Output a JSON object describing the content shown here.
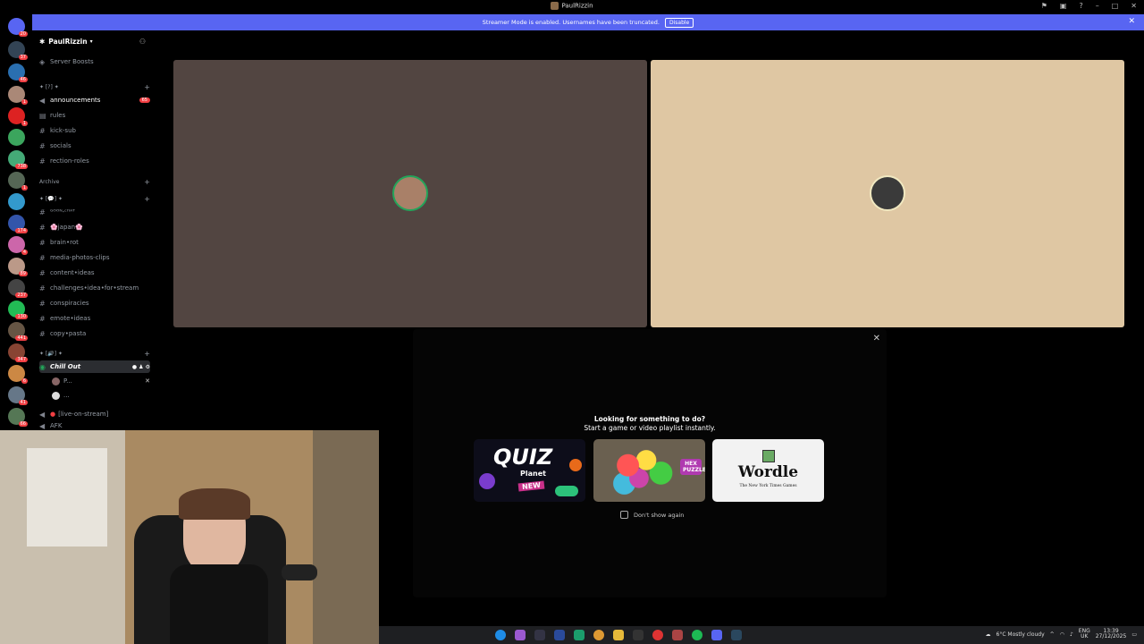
{
  "window": {
    "title": "PaulRizzin"
  },
  "streamer_banner": {
    "text": "Streamer Mode is enabled. Usernames have been truncated.",
    "disable_label": "Disable"
  },
  "server_rail": {
    "badges": [
      "20",
      "37",
      "46",
      "1",
      "1",
      "738",
      "1",
      "174",
      "4",
      "89",
      "237",
      "130",
      "441",
      "347",
      "6",
      "41",
      "66"
    ]
  },
  "sidebar": {
    "server_name": "PaulRizzin",
    "boosts_label": "Server Boosts",
    "cat1": "✦ [?] ✦",
    "channels": [
      {
        "name": "announcements",
        "badge": "65"
      },
      {
        "name": "rules"
      },
      {
        "name": "kick-sub"
      },
      {
        "name": "socials"
      },
      {
        "name": "rection-roles"
      }
    ],
    "archive_label": "Archive",
    "cat2": "✦ [💬] ✦",
    "archive_channels": [
      "ᴳᴼᴼᴺ-ᶜᴴᴬᵀ",
      "🌸japan🌸",
      "brain•rot",
      "media-photos-clips",
      "content•ideas",
      "challenges•idea•for•stream",
      "conspiracies",
      "emote•ideas",
      "copy•pasta"
    ],
    "cat3": "✦ [🔊] ✦",
    "voice_channel": "Chill Out",
    "voice_users": [
      "P...",
      "..."
    ],
    "live_channel": "[live-on-stream]",
    "afk_label": "AFK"
  },
  "activity": {
    "title_line1": "Looking for something to do?",
    "title_line2": "Start a game or video playlist instantly.",
    "cards": [
      {
        "name": "QUIZ",
        "sub": "Planet",
        "tag": "NEW"
      },
      {
        "name": "HEX PUZZLE"
      },
      {
        "name": "Wordle",
        "sub": "The New York Times Games"
      }
    ],
    "dont_show": "Don't show again"
  },
  "tray": {
    "weather": "6°C Mostly cloudy",
    "lang": "ENG",
    "region": "UK",
    "time": "13:39",
    "date": "27/12/2025"
  },
  "colors": {
    "blurple": "#5865f2",
    "tile_left": "#524541",
    "tile_right": "#dfc7a3",
    "speaking": "#23a55a"
  }
}
